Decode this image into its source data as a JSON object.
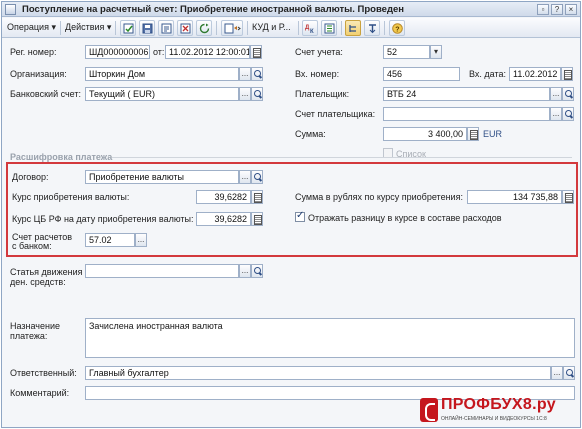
{
  "window": {
    "title": "Поступление на расчетный счет: Приобретение иностранной валюты. Проведен"
  },
  "toolbar": {
    "operation_label": "Операция ▾",
    "actions_label": "Действия ▾",
    "kud_label": "КУД и Р..."
  },
  "header": {
    "reg_number_label": "Рег. номер:",
    "reg_number": "ШД000000006",
    "date_from_label": "от:",
    "date": "11.02.2012 12:00:01",
    "organization_label": "Организация:",
    "organization": "Шторкин Дом",
    "bank_account_label": "Банковский счет:",
    "bank_account": "Текущий ( EUR)",
    "account_label": "Счет учета:",
    "account": "52",
    "in_number_label": "Вх. номер:",
    "in_number": "456",
    "in_date_label": "Вх. дата:",
    "in_date": "11.02.2012",
    "payer_label": "Плательщик:",
    "payer": "ВТБ 24",
    "payer_account_label": "Счет плательщика:",
    "payer_account": "",
    "amount_label": "Сумма:",
    "amount": "3 400,00",
    "currency": "EUR",
    "list_label": "Список"
  },
  "decoding": {
    "section_title": "Расшифровка платежа",
    "contract_label": "Договор:",
    "contract": "Приобретение валюты",
    "rate_label": "Курс приобретения валюты:",
    "rate": "39,6282",
    "cbr_rate_label": "Курс ЦБ РФ на дату приобретения валюты:",
    "cbr_rate": "39,6282",
    "bank_account_label_1": "Счет расчетов",
    "bank_account_label_2": "с банком:",
    "bank_account": "57.02",
    "rub_sum_label": "Сумма в рублях по курсу приобретения:",
    "rub_sum": "134 735,88",
    "diff_label": "Отражать разницу в курсе в составе расходов"
  },
  "cashflow": {
    "label_1": "Статья движения",
    "label_2": "ден. средств:",
    "value": ""
  },
  "footer": {
    "purpose_label_1": "Назначение",
    "purpose_label_2": "платежа:",
    "purpose": "Зачислена иностранная валюта",
    "responsible_label": "Ответственный:",
    "responsible": "Главный бухгалтер",
    "comment_label": "Комментарий:",
    "comment": ""
  },
  "logo": {
    "name": "ПРОФБУХ8.ру",
    "tagline": "ОНЛАЙН-СЕМИНАРЫ И ВИДЕОКУРСЫ 1С:8"
  },
  "colors": {
    "highlight_frame": "#d3393d",
    "logo_red": "#c5161d"
  }
}
